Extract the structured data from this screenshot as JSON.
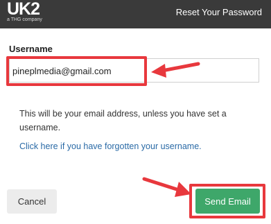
{
  "header": {
    "logo_text": "UK2",
    "logo_subtext": "a THG company",
    "title": "Reset Your Password"
  },
  "form": {
    "username_label": "Username",
    "username_value": "pineplmedia@gmail.com",
    "help_text": "This will be your email address, unless you have set a username.",
    "forgot_link": "Click here if you have forgotten your username."
  },
  "buttons": {
    "cancel": "Cancel",
    "send": "Send Email"
  },
  "colors": {
    "header_bg": "#3a3a3a",
    "send_button": "#3ea76a",
    "annotation": "#e8383d",
    "link": "#2a6aa6"
  },
  "icons": [
    "arrow-left-annotation-icon",
    "arrow-down-right-annotation-icon"
  ]
}
